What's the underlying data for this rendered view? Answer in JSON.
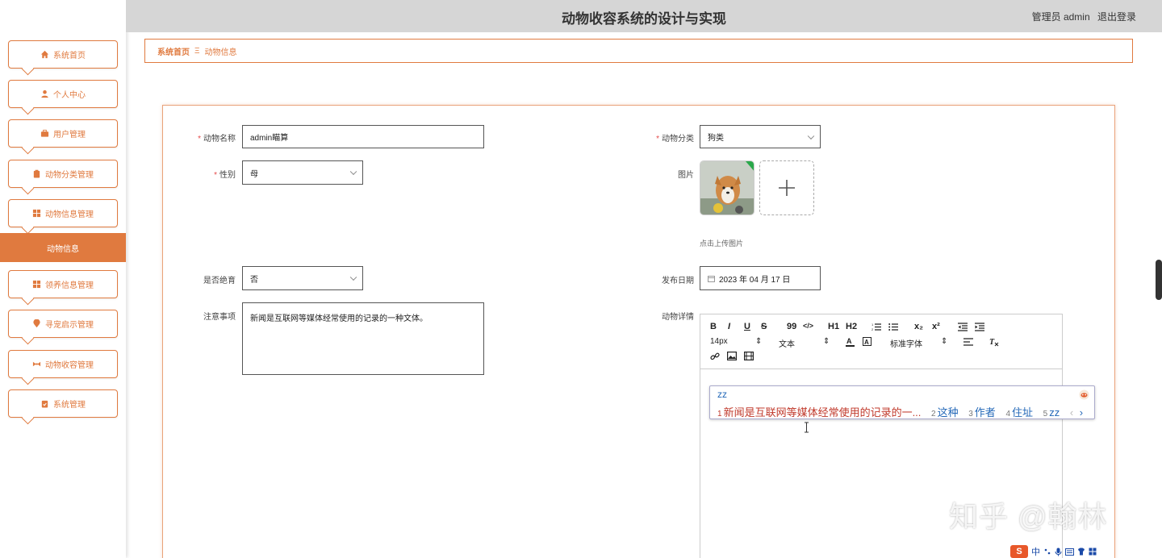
{
  "app": {
    "title": "动物收容系统的设计与实现",
    "user_role": "管理员 admin",
    "logout": "退出登录"
  },
  "sidebar": {
    "items": [
      {
        "label": "系统首页",
        "icon": "home-icon"
      },
      {
        "label": "个人中心",
        "icon": "person-icon"
      },
      {
        "label": "用户管理",
        "icon": "briefcase-icon"
      },
      {
        "label": "动物分类管理",
        "icon": "clipboard-icon"
      },
      {
        "label": "动物信息管理",
        "icon": "grid-icon"
      },
      {
        "label": "动物信息",
        "icon": "",
        "active": true
      },
      {
        "label": "领养信息管理",
        "icon": "grid-icon"
      },
      {
        "label": "寻宠启示管理",
        "icon": "location-icon"
      },
      {
        "label": "动物收容管理",
        "icon": "shelter-icon"
      },
      {
        "label": "系统管理",
        "icon": "clipboard-check-icon"
      }
    ]
  },
  "breadcrumb": {
    "home": "系统首页",
    "separator": "Ξ",
    "current": "动物信息"
  },
  "form": {
    "name_label": "动物名称",
    "name_value": "admin瞄算",
    "category_label": "动物分类",
    "category_value": "狗类",
    "gender_label": "性别",
    "gender_value": "母",
    "image_label": "图片",
    "upload_tip": "点击上传图片",
    "sterilized_label": "是否绝育",
    "sterilized_value": "否",
    "date_label": "发布日期",
    "date_value": "2023 年 04 月 17 日",
    "notes_label": "注意事项",
    "notes_value": "新闻是互联网等媒体经常使用的记录的一种文体。",
    "detail_label": "动物详情",
    "required_mark": "*"
  },
  "editor": {
    "toolbar_row1": [
      "B",
      "I",
      "U",
      "S",
      "99",
      "</>",
      "H1",
      "H2",
      "ol",
      "ul",
      "x₂",
      "x²",
      "outdent",
      "indent"
    ],
    "font_size": "14px",
    "font_size_arrow": "⇕",
    "text_type": "文本",
    "text_type_arrow": "⇕",
    "font_family": "标准字体",
    "font_family_arrow": "⇕",
    "content": "zz"
  },
  "ime": {
    "code": "zz",
    "candidates": [
      {
        "num": "1",
        "text": "新闻是互联网等媒体经常使用的记录的一..."
      },
      {
        "num": "2",
        "text": "这种"
      },
      {
        "num": "3",
        "text": "作者"
      },
      {
        "num": "4",
        "text": "住址"
      },
      {
        "num": "5",
        "text": "zz"
      }
    ],
    "page_prev": "‹",
    "page_next": "›"
  },
  "watermark": "知乎 @翰林",
  "taskbar_ime": {
    "logo": "S",
    "mode": "中"
  },
  "colors": {
    "accent": "#e07a3f",
    "topbar": "#d6d6d6",
    "required": "#e54b4b",
    "ime_blue": "#2468b8"
  }
}
